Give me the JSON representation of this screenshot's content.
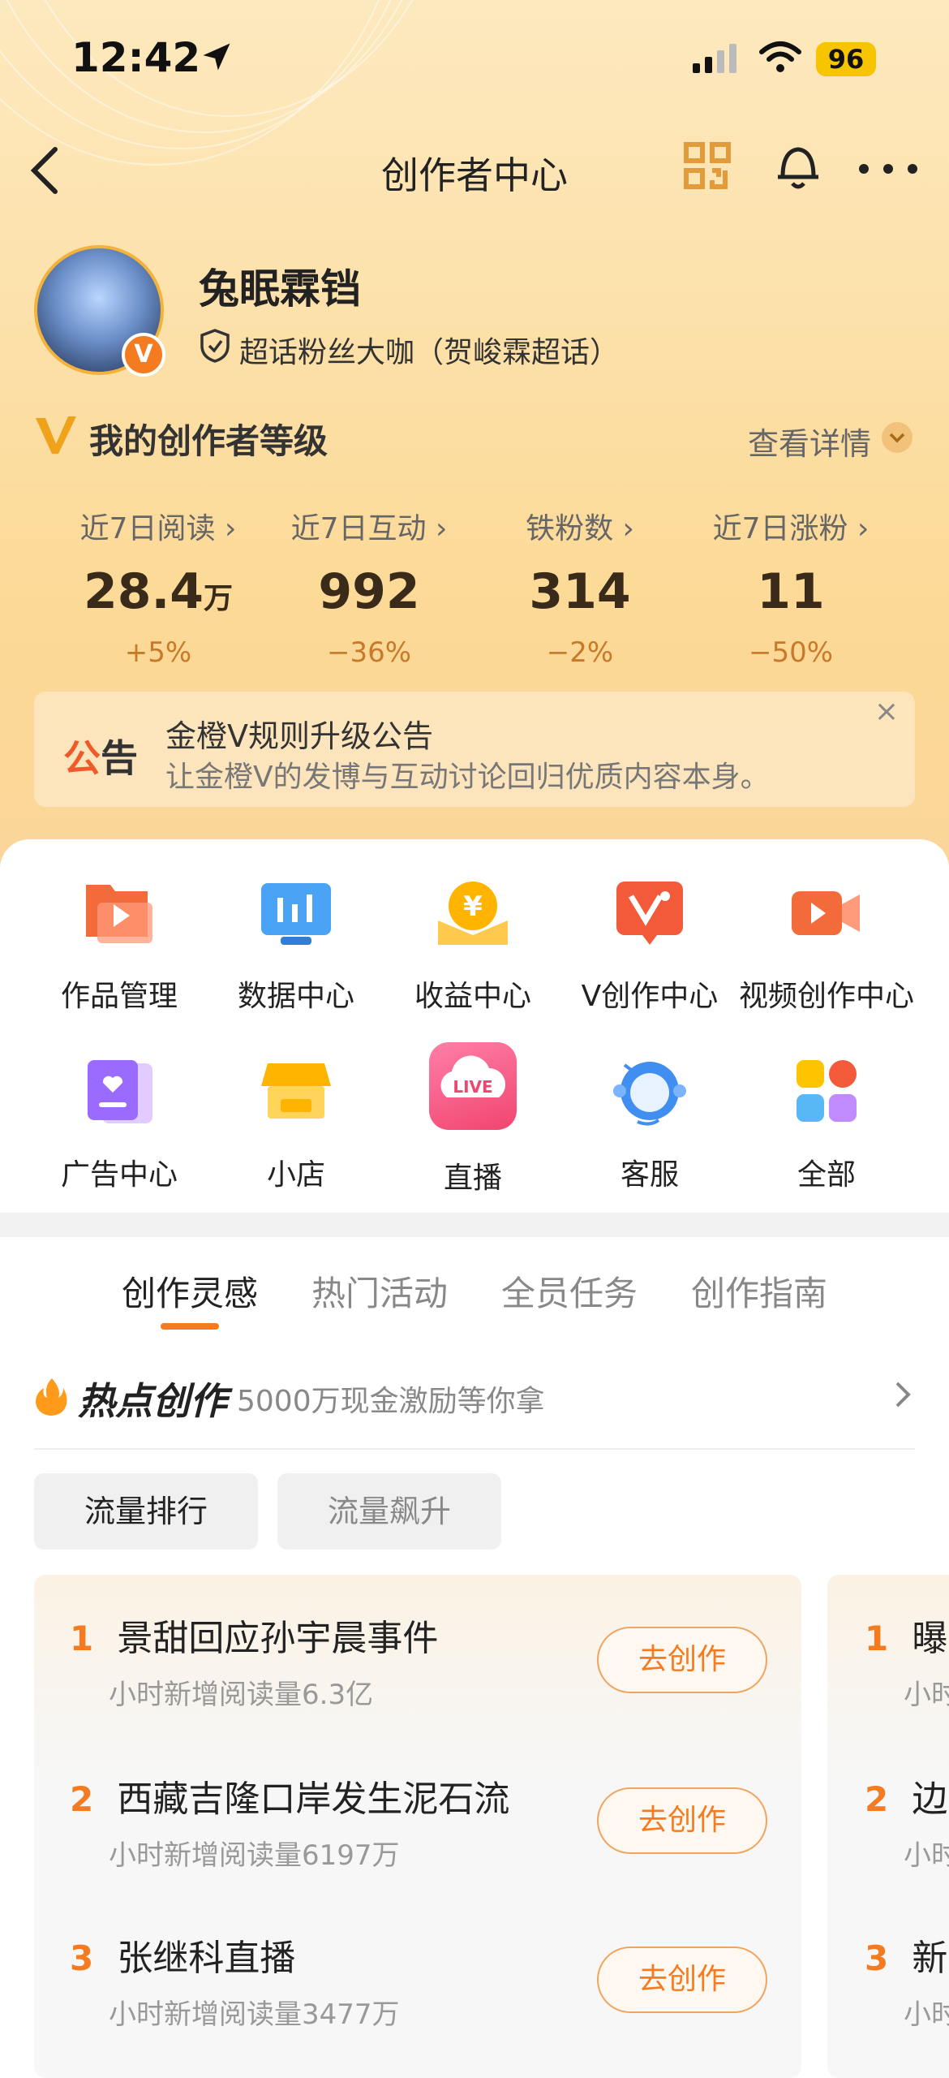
{
  "status_bar": {
    "time": "12:42",
    "battery": "96"
  },
  "nav": {
    "title": "创作者中心"
  },
  "profile": {
    "name": "兔眠霖铛",
    "tag": "超话粉丝大咖（贺峻霖超话）",
    "badge": "V"
  },
  "level": {
    "title": "我的创作者等级",
    "detail": "查看详情"
  },
  "stats": [
    {
      "label": "近7日阅读 ›",
      "value": "28.4",
      "unit": "万",
      "change": "+5%"
    },
    {
      "label": "近7日互动 ›",
      "value": "992",
      "unit": "",
      "change": "−36%"
    },
    {
      "label": "铁粉数 ›",
      "value": "314",
      "unit": "",
      "change": "−2%"
    },
    {
      "label": "近7日涨粉 ›",
      "value": "11",
      "unit": "",
      "change": "−50%"
    }
  ],
  "notice": {
    "tag1": "公",
    "tag2": "告",
    "title": "金橙V规则升级公告",
    "desc": "让金橙V的发博与互动讨论回归优质内容本身。",
    "close": "×"
  },
  "grid": [
    {
      "label": "作品管理",
      "icon": "works-icon"
    },
    {
      "label": "数据中心",
      "icon": "data-icon"
    },
    {
      "label": "收益中心",
      "icon": "income-icon"
    },
    {
      "label": "V创作中心",
      "icon": "v-create-icon"
    },
    {
      "label": "视频创作中心",
      "icon": "video-icon"
    },
    {
      "label": "广告中心",
      "icon": "ad-icon"
    },
    {
      "label": "小店",
      "icon": "shop-icon"
    },
    {
      "label": "直播",
      "icon": "live-icon"
    },
    {
      "label": "客服",
      "icon": "service-icon"
    },
    {
      "label": "全部",
      "icon": "all-icon"
    }
  ],
  "live_badge": "LIVE",
  "tabs": [
    "创作灵感",
    "热门活动",
    "全员任务",
    "创作指南"
  ],
  "hot": {
    "title": "热点创作",
    "subtitle": "5000万现金激励等你拿"
  },
  "filters": [
    "流量排行",
    "流量飙升"
  ],
  "list": [
    {
      "rank": "1",
      "title": "景甜回应孙宇晨事件",
      "sub": "小时新增阅读量6.3亿",
      "btn": "去创作"
    },
    {
      "rank": "2",
      "title": "西藏吉隆口岸发生泥石流",
      "sub": "小时新增阅读量6197万",
      "btn": "去创作"
    },
    {
      "rank": "3",
      "title": "张继科直播",
      "sub": "小时新增阅读量3477万",
      "btn": "去创作"
    }
  ],
  "list2": [
    {
      "rank": "1",
      "title": "曝孙",
      "sub": "小时"
    },
    {
      "rank": "2",
      "title": "边境",
      "sub": "小时"
    },
    {
      "rank": "3",
      "title": "新生",
      "sub": "小时"
    }
  ]
}
